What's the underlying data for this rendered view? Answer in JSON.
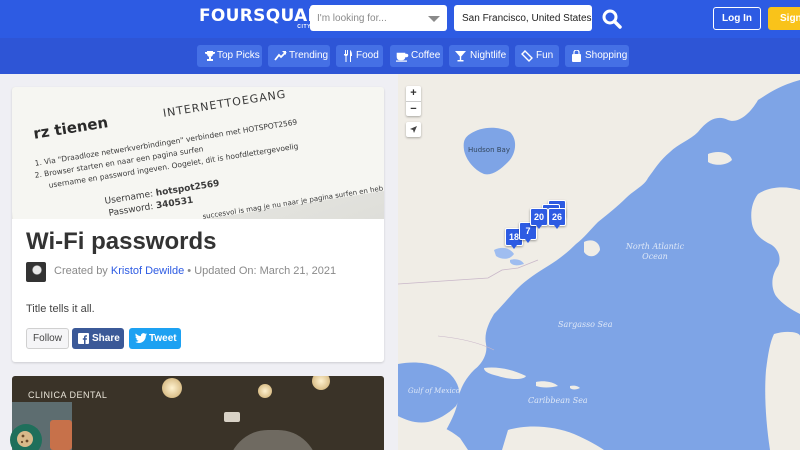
{
  "header": {
    "brand": "FOURSQUARE",
    "brand_sub": "CITY GUIDE",
    "search_placeholder": "I'm looking for...",
    "location_value": "San Francisco, United States",
    "login_label": "Log In",
    "signup_label": "Sign",
    "brand_color": "#2d5be3",
    "signup_color": "#f9c31a"
  },
  "categories": [
    {
      "label": "Top Picks",
      "icon": "trophy-icon"
    },
    {
      "label": "Trending",
      "icon": "trending-icon"
    },
    {
      "label": "Food",
      "icon": "fork-knife-icon"
    },
    {
      "label": "Coffee",
      "icon": "coffee-cup-icon"
    },
    {
      "label": "Nightlife",
      "icon": "cocktail-icon"
    },
    {
      "label": "Fun",
      "icon": "ticket-icon"
    },
    {
      "label": "Shopping",
      "icon": "shopping-bag-icon"
    }
  ],
  "card": {
    "title": "Wi-Fi passwords",
    "created_by_prefix": "Created by",
    "author": "Kristof Dewilde",
    "updated": "• Updated On: March 21, 2021",
    "body": "Title tells it all.",
    "follow_label": "Follow",
    "share_label": "Share",
    "tweet_label": "Tweet",
    "image_text": {
      "logo": "rz tienen",
      "header": "INTERNETTOEGANG",
      "line1": "1. Via \"Draadloze netwerkverbindingen\" verbinden met HOTSPOT2569",
      "line2": "2. Browser starten en naar een pagina surfen",
      "line3": "username en password ingeven. Oogelet, dit is hoofdlettergevoelig",
      "username_label": "Username:",
      "username_value": "hotspot2569",
      "password_label": "Password:",
      "password_value": "340531",
      "footer": "succesvol is mag je nu naar je pagina surfen en heb je internet"
    }
  },
  "card2": {
    "sign_text": "CLINICA DENTAL"
  },
  "map": {
    "pins": [
      {
        "label": "18"
      },
      {
        "label": "7"
      },
      {
        "label": "20"
      },
      {
        "label": "26"
      }
    ],
    "labels": {
      "hudson_bay": "Hudson Bay",
      "north_atlantic": "North Atlantic Ocean",
      "sargasso": "Sargasso Sea",
      "caribbean": "Caribbean Sea",
      "gulf": "Gulf of Mexico"
    },
    "zoom_in": "+",
    "zoom_out": "−",
    "land_color": "#f0ede6",
    "water_color": "#7ea4e6"
  }
}
